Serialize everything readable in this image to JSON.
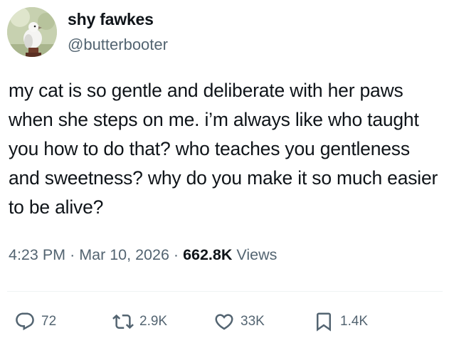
{
  "author": {
    "display_name": "shy fawkes",
    "handle": "@butterbooter",
    "avatar_icon": "pigeon-avatar"
  },
  "tweet": {
    "text": "my cat is so gentle and deliberate with her paws when she steps on me. i’m always like who taught you how to do that? who teaches you gentleness and sweetness? why do you make it so much easier to be alive?",
    "time": "4:23 PM",
    "separator": "·",
    "date": "Mar 10, 2026",
    "views_count": "662.8K",
    "views_label": "Views"
  },
  "actions": {
    "reply": {
      "icon": "reply-icon",
      "count": "72"
    },
    "retweet": {
      "icon": "retweet-icon",
      "count": "2.9K"
    },
    "like": {
      "icon": "heart-icon",
      "count": "33K"
    },
    "bookmark": {
      "icon": "bookmark-icon",
      "count": "1.4K"
    }
  },
  "colors": {
    "text_primary": "#0f1419",
    "text_secondary": "#536471",
    "divider": "#eff3f4"
  }
}
